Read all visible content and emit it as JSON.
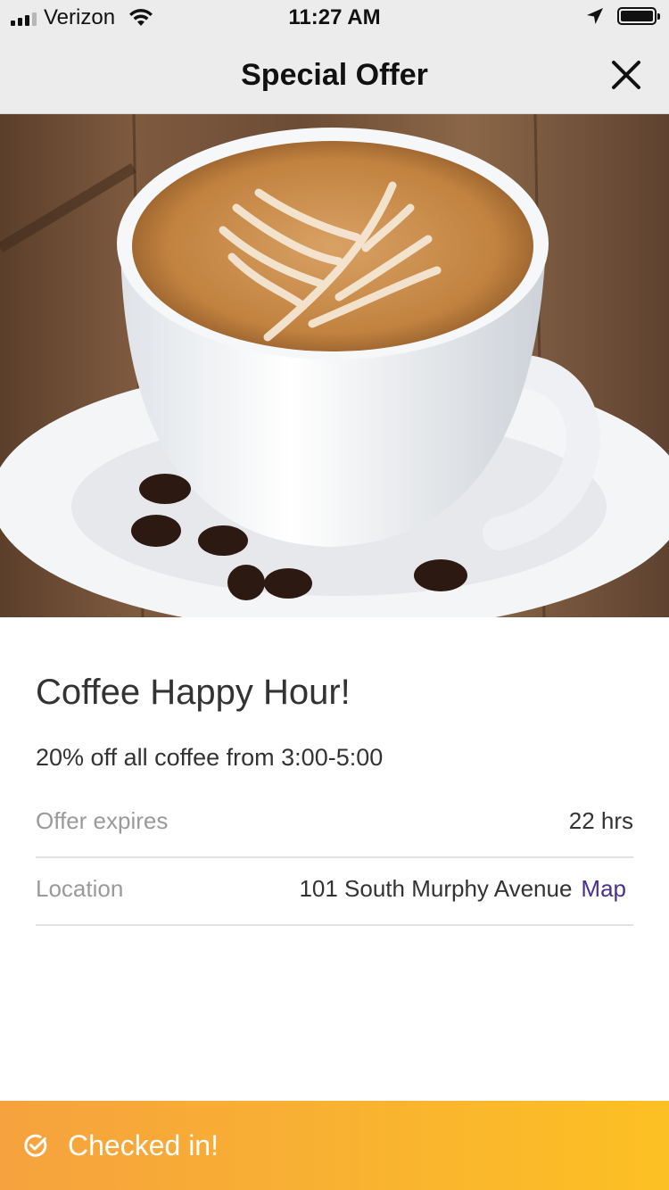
{
  "status_bar": {
    "carrier": "Verizon",
    "time": "11:27 AM",
    "battery_level": 1.0
  },
  "nav": {
    "title": "Special Offer",
    "close_icon": "close-icon"
  },
  "hero": {
    "image": "latte-art-coffee-cup-photo"
  },
  "offer": {
    "title": "Coffee Happy Hour!",
    "description": "20% off all coffee from 3:00-5:00",
    "expires_label": "Offer expires",
    "expires_value": "22 hrs",
    "location_label": "Location",
    "location_value": "101 South Murphy Avenue",
    "map_link": "Map"
  },
  "checkin": {
    "label": "Checked in!",
    "icon": "check-circle-icon"
  },
  "colors": {
    "map_link": "#4b2f8c",
    "banner_start": "#f6a23e",
    "banner_end": "#fcc023",
    "nav_background": "#ececec"
  }
}
